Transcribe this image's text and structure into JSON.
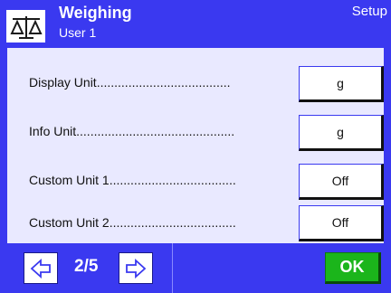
{
  "header": {
    "icon": "balance-scale-icon",
    "title": "Weighing",
    "user": "User 1",
    "mode": "Setup"
  },
  "rows": [
    {
      "label": "Display Unit......................................",
      "value": "g"
    },
    {
      "label": "Info Unit.............................................",
      "value": "g"
    },
    {
      "label": "Custom Unit 1....................................",
      "value": "Off"
    },
    {
      "label": "Custom Unit 2....................................",
      "value": "Off"
    }
  ],
  "footer": {
    "page": "2/5",
    "ok_label": "OK",
    "prev_icon": "arrow-left-icon",
    "next_icon": "arrow-right-icon"
  },
  "colors": {
    "accent": "#3a39f0",
    "panel": "#e9e9ff",
    "ok": "#1bb51b"
  }
}
